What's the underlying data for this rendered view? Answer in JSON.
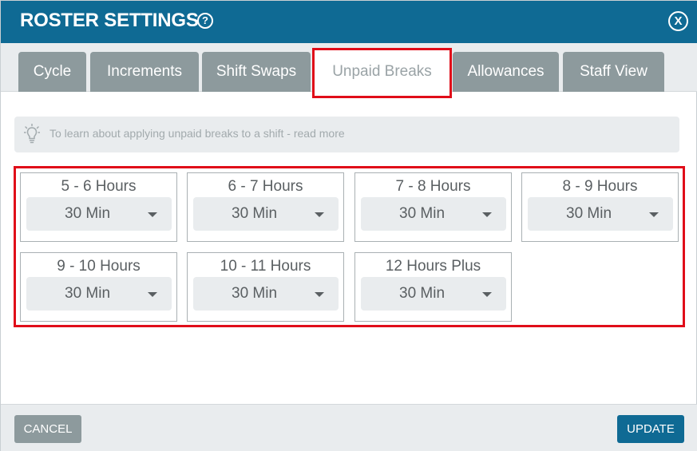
{
  "header": {
    "title": "ROSTER SETTINGS",
    "help_glyph": "?",
    "close_glyph": "X"
  },
  "tabs": [
    {
      "label": "Cycle",
      "active": false
    },
    {
      "label": "Increments",
      "active": false
    },
    {
      "label": "Shift Swaps",
      "active": false
    },
    {
      "label": "Unpaid Breaks",
      "active": true
    },
    {
      "label": "Allowances",
      "active": false
    },
    {
      "label": "Staff View",
      "active": false
    }
  ],
  "info": {
    "icon": "lightbulb-icon",
    "text": "To learn about applying unpaid breaks to a shift - read more"
  },
  "breaks": [
    {
      "range": "5 - 6 Hours",
      "value": "30 Min"
    },
    {
      "range": "6 - 7 Hours",
      "value": "30 Min"
    },
    {
      "range": "7 - 8 Hours",
      "value": "30 Min"
    },
    {
      "range": "8 - 9 Hours",
      "value": "30 Min"
    },
    {
      "range": "9 - 10 Hours",
      "value": "30 Min"
    },
    {
      "range": "10 - 11 Hours",
      "value": "30 Min"
    },
    {
      "range": "12 Hours Plus",
      "value": "30 Min"
    }
  ],
  "footer": {
    "cancel_label": "CANCEL",
    "update_label": "UPDATE"
  },
  "colors": {
    "header": "#0f6a94",
    "tab_inactive": "#8d9a9d",
    "highlight": "#e00d19",
    "panel": "#e9ecee"
  }
}
